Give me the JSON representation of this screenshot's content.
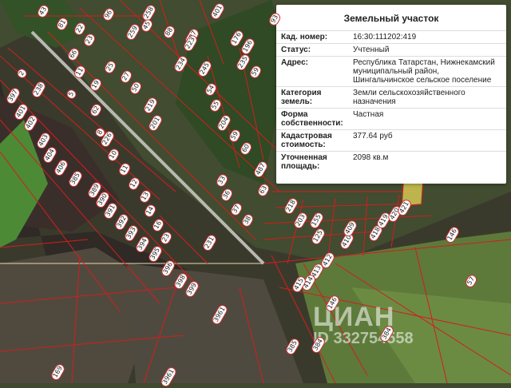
{
  "info": {
    "title": "Земельный участок",
    "rows": [
      {
        "key": "Кад. номер:",
        "value": "16:30:111202:419"
      },
      {
        "key": "Статус:",
        "value": "Учтенный"
      },
      {
        "key": "Адрес:",
        "value": "Республика Татарстан, Нижнекамский муниципальный район, Шингальчинское сельское поселение"
      },
      {
        "key": "Категория земель:",
        "value": "Земли сельскохозяйственного назначения"
      },
      {
        "key": "Форма собственности:",
        "value": "Частная"
      },
      {
        "key": "Кадастровая стоимость:",
        "value": "377.64 руб"
      },
      {
        "key": "Уточненная площадь:",
        "value": "2098 кв.м"
      }
    ]
  },
  "watermark": {
    "logo": "ЦИАН",
    "id": "ID 332754558"
  },
  "plots": [
    "43",
    "81",
    "96",
    "258",
    "401",
    "93",
    "22",
    "23",
    "259",
    "45",
    "88",
    "227",
    "176",
    "196",
    "235",
    "2",
    "66",
    "11",
    "234",
    "245",
    "59",
    "223",
    "397",
    "5",
    "19",
    "238",
    "25",
    "27",
    "50",
    "8",
    "62",
    "401",
    "402",
    "403",
    "404",
    "406",
    "385",
    "389",
    "390",
    "391",
    "392",
    "393",
    "394",
    "395",
    "396",
    "398",
    "399",
    "226",
    "10",
    "11",
    "12",
    "13",
    "14",
    "16",
    "23",
    "231",
    "219",
    "201",
    "54",
    "55",
    "204",
    "59",
    "60",
    "63",
    "487",
    "33",
    "36",
    "37",
    "38",
    "203",
    "155",
    "218",
    "125",
    "410",
    "412",
    "413",
    "414",
    "415",
    "409",
    "418",
    "419",
    "420",
    "421",
    "146",
    "57",
    "3961",
    "3961",
    "146",
    "385",
    "384",
    "384",
    "169"
  ]
}
